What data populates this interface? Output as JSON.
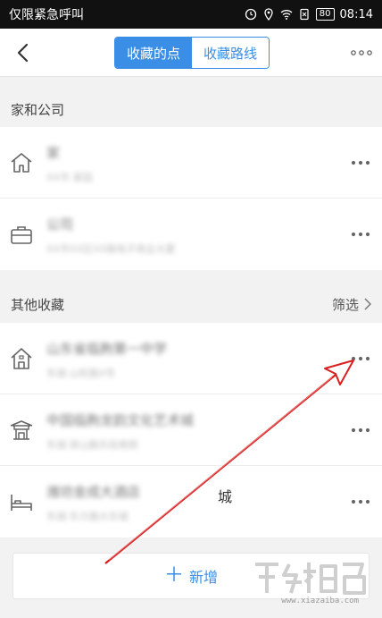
{
  "statusbar": {
    "carrier": "仅限紧急呼叫",
    "battery": "80",
    "time": "08:14"
  },
  "header": {
    "tabs": [
      {
        "label": "收藏的点",
        "active": true
      },
      {
        "label": "收藏路线",
        "active": false
      }
    ]
  },
  "home_section": {
    "title": "家和公司",
    "items": [
      {
        "icon": "home-icon",
        "name": "家",
        "sub": "XX市 家园"
      },
      {
        "icon": "briefcase-icon",
        "name": "公司",
        "sub": "XX市XX区XX路电子商业大厦"
      }
    ]
  },
  "other_section": {
    "title": "其他收藏",
    "filter_label": "筛选",
    "items": [
      {
        "icon": "house-icon",
        "name": "山东省临朐第一中学",
        "sub": "东城·山旺路X号"
      },
      {
        "icon": "pavilion-icon",
        "name": "中国临朐龙韵文化艺术城",
        "sub": "东城·骈山路东段南侧"
      },
      {
        "icon": "bed-icon",
        "name": "潍坊金成大酒店",
        "sub": "东城·东方路大东城"
      }
    ]
  },
  "other_item_extra": "城",
  "add_button": {
    "label": "新增"
  },
  "watermark": {
    "text": "www.xiazaiba.com"
  },
  "colors": {
    "accent": "#3a8ee6",
    "arrow": "#d81e1e"
  }
}
